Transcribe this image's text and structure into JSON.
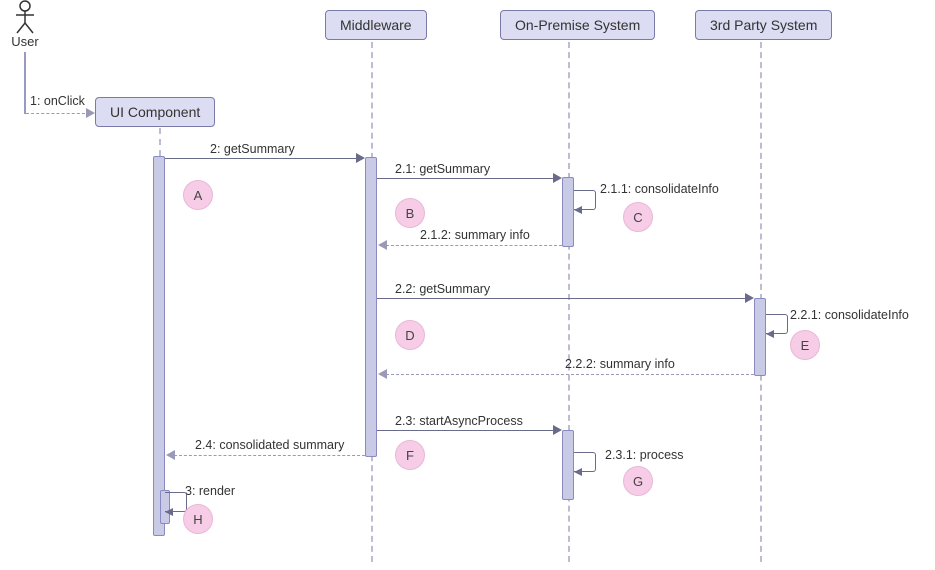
{
  "actors": {
    "user": {
      "label": "User"
    }
  },
  "lifelines": {
    "ui": {
      "label": "UI Component"
    },
    "mw": {
      "label": "Middleware"
    },
    "op": {
      "label": "On-Premise System"
    },
    "tp": {
      "label": "3rd Party System"
    }
  },
  "messages": {
    "m1": "1: onClick",
    "m2": "2: getSummary",
    "m2_1": "2.1: getSummary",
    "m2_1_1": "2.1.1: consolidateInfo",
    "m2_1_2": "2.1.2: summary info",
    "m2_2": "2.2: getSummary",
    "m2_2_1": "2.2.1: consolidateInfo",
    "m2_2_2": "2.2.2: summary info",
    "m2_3": "2.3: startAsyncProcess",
    "m2_3_1": "2.3.1: process",
    "m2_4": "2.4: consolidated summary",
    "m3": "3: render"
  },
  "annotations": {
    "A": "A",
    "B": "B",
    "C": "C",
    "D": "D",
    "E": "E",
    "F": "F",
    "G": "G",
    "H": "H"
  }
}
